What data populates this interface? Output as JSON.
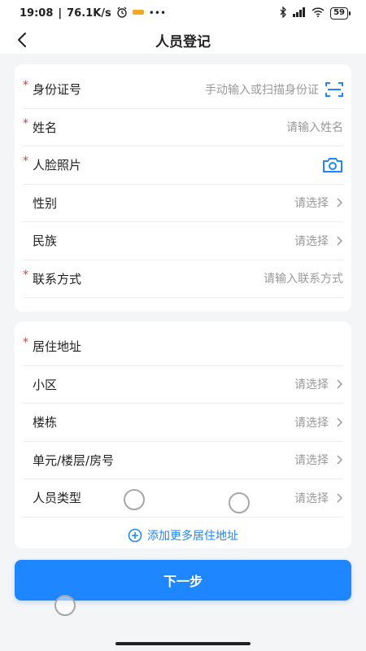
{
  "status_bar": {
    "time": "19:08",
    "speed": "76.1K/s",
    "battery": "59"
  },
  "header": {
    "title": "人员登记"
  },
  "basic_info": {
    "id_card": {
      "label": "身份证号",
      "placeholder": "手动输入或扫描身份证"
    },
    "name": {
      "label": "姓名",
      "placeholder": "请输入姓名"
    },
    "face_photo": {
      "label": "人脸照片"
    },
    "gender": {
      "label": "性别",
      "value": "请选择"
    },
    "ethnicity": {
      "label": "民族",
      "value": "请选择"
    },
    "contact": {
      "label": "联系方式",
      "placeholder": "请输入联系方式"
    }
  },
  "address": {
    "section_label": "居住地址",
    "community": {
      "label": "小区",
      "value": "请选择"
    },
    "building": {
      "label": "楼栋",
      "value": "请选择"
    },
    "unit_floor_room": {
      "label": "单元/楼层/房号",
      "value": "请选择"
    },
    "person_type": {
      "label": "人员类型",
      "value": "请选择"
    },
    "add_more": "添加更多居住地址"
  },
  "actions": {
    "next": "下一步"
  },
  "colors": {
    "accent": "#1e86ff",
    "required": "#e53935",
    "placeholder": "#9a9a9a"
  },
  "icons": {
    "back": "chevron-left-icon",
    "scan": "scan-icon",
    "camera": "camera-icon",
    "chevron": "chevron-right-icon",
    "add": "plus-circle-icon"
  }
}
